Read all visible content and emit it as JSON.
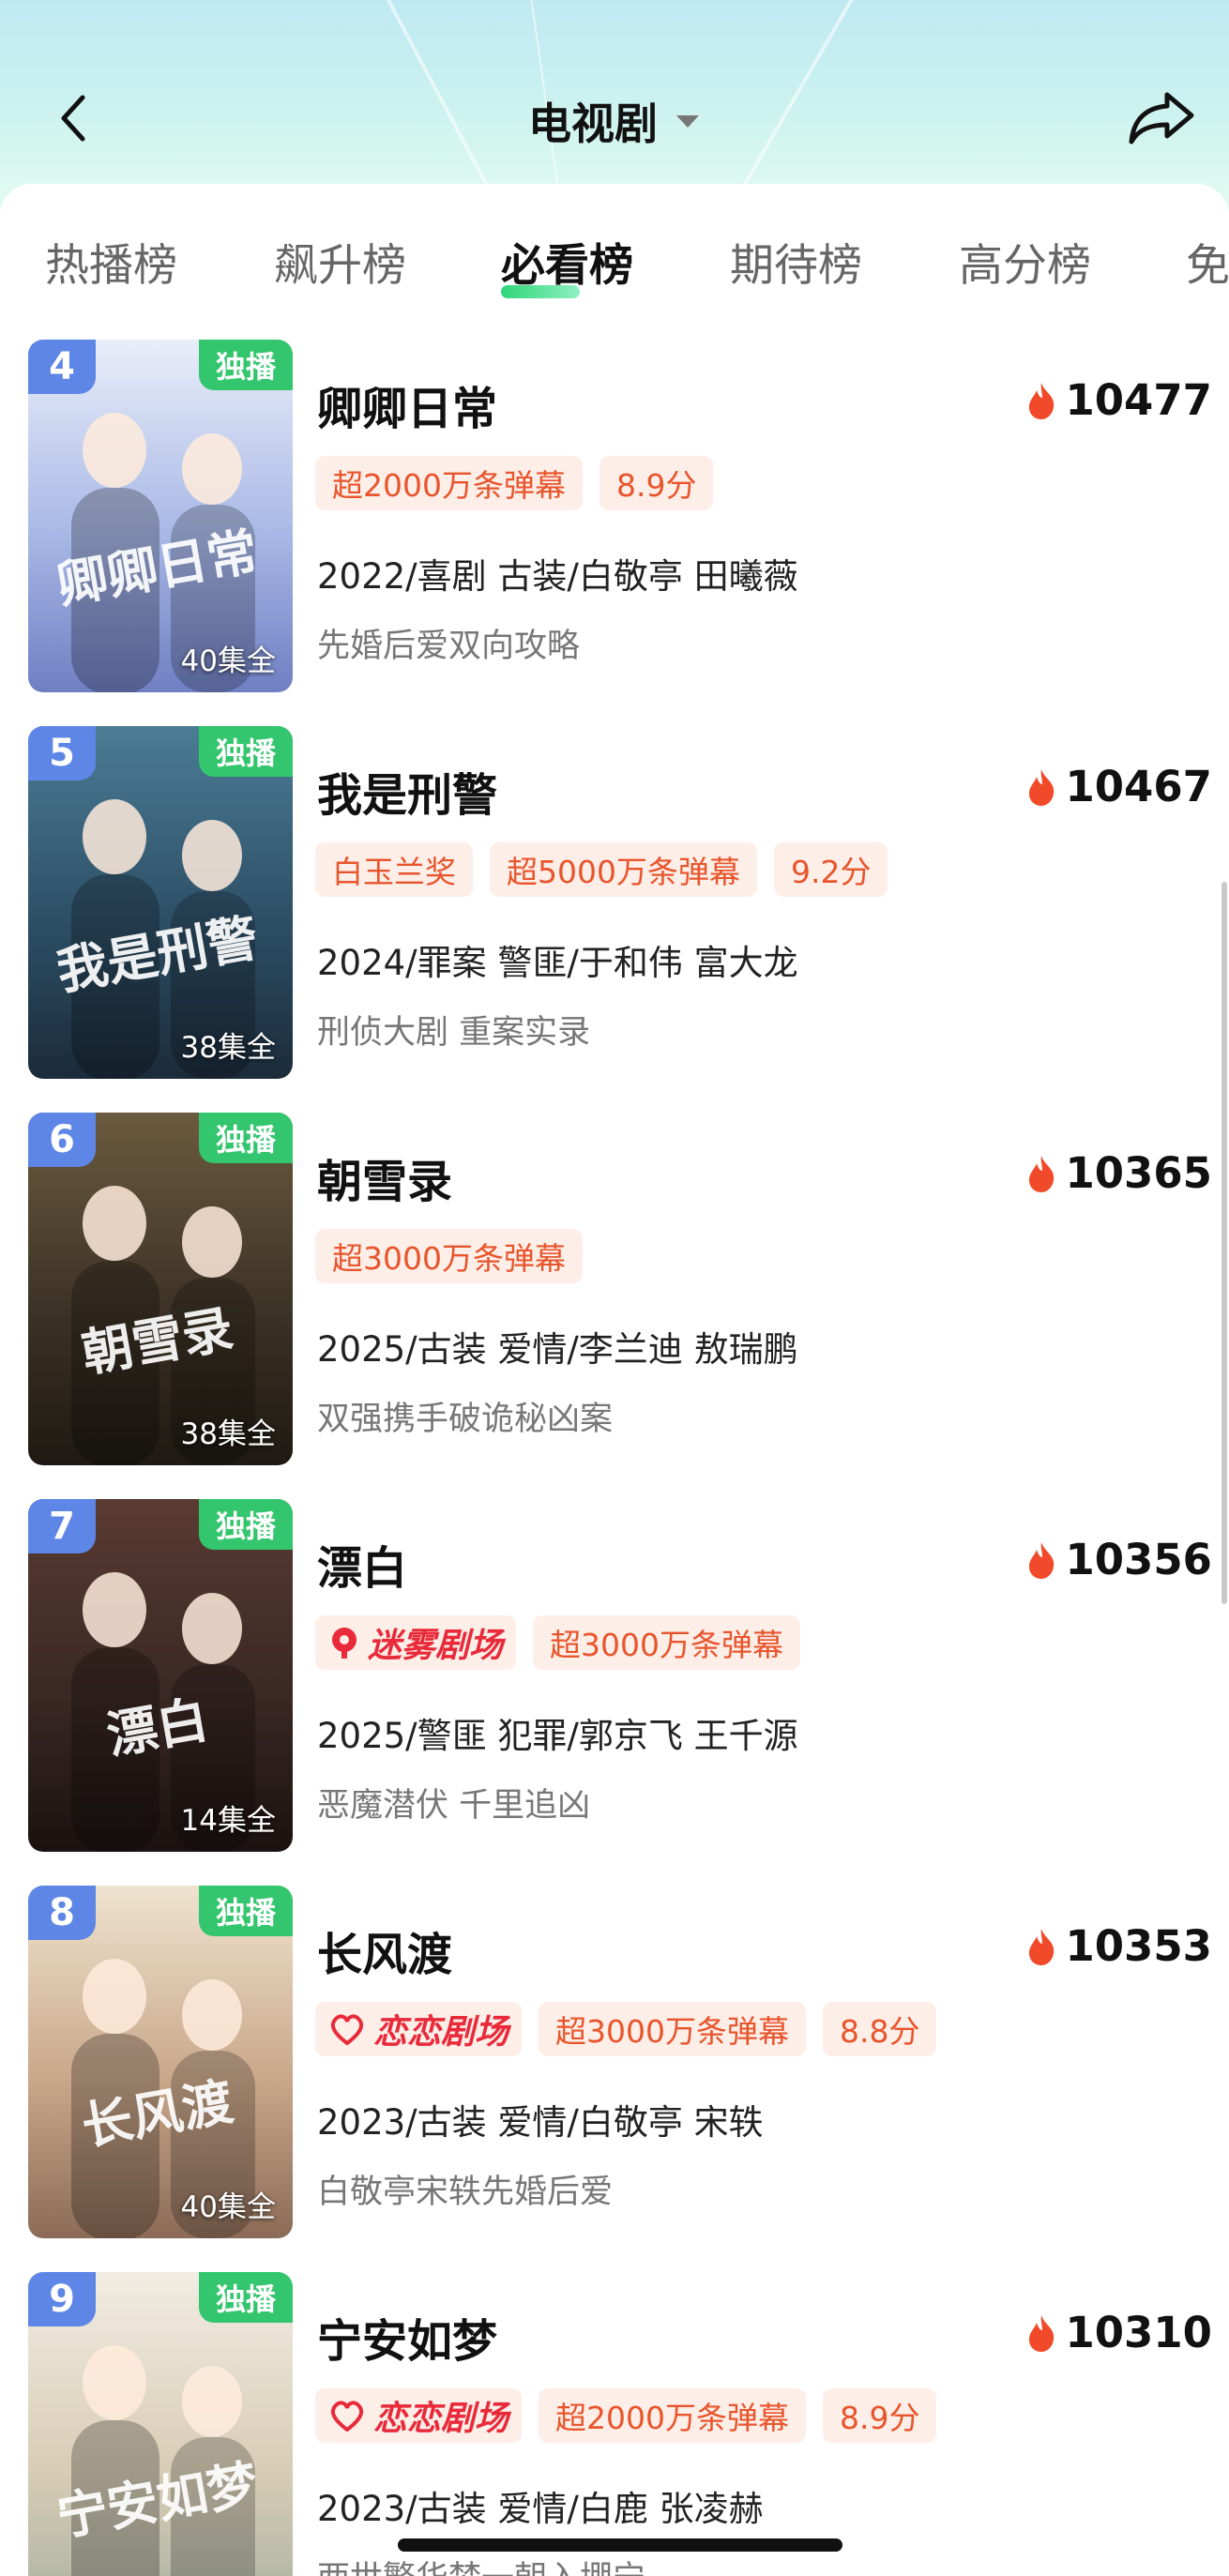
{
  "header": {
    "title": "电视剧",
    "back_icon": "chevron-left-icon",
    "dropdown_icon": "caret-down-icon",
    "share_icon": "share-arrow-icon"
  },
  "tabs": [
    {
      "label": "热播榜",
      "active": false
    },
    {
      "label": "飙升榜",
      "active": false
    },
    {
      "label": "必看榜",
      "active": true
    },
    {
      "label": "期待榜",
      "active": false
    },
    {
      "label": "高分榜",
      "active": false
    },
    {
      "label": "免",
      "active": false
    }
  ],
  "colors": {
    "accent_green": "#34c66e",
    "rank_blue": "#5d86e6",
    "tag_text": "#e8552c",
    "tag_bg": "#fdeee8",
    "heat_fire": "#f04a2a"
  },
  "list": [
    {
      "rank": "4",
      "exclusive": "独播",
      "episodes": "40集全",
      "title": "卿卿日常",
      "heat": "10477",
      "tags": [
        {
          "type": "text",
          "text": "超2000万条弹幕"
        },
        {
          "type": "text",
          "text": "8.9分"
        }
      ],
      "meta": "2022/喜剧 古装/白敬亭 田曦薇",
      "desc": "先婚后爱双向攻略",
      "poster_text": "卿卿日常",
      "poster_colors": [
        "#e9eef9",
        "#a8b8e6",
        "#6f7fc2"
      ]
    },
    {
      "rank": "5",
      "exclusive": "独播",
      "episodes": "38集全",
      "title": "我是刑警",
      "heat": "10467",
      "tags": [
        {
          "type": "text",
          "text": "白玉兰奖"
        },
        {
          "type": "text",
          "text": "超5000万条弹幕"
        },
        {
          "type": "text",
          "text": "9.2分"
        }
      ],
      "meta": "2024/罪案 警匪/于和伟 富大龙",
      "desc": "刑侦大剧 重案实录",
      "poster_text": "我是刑警",
      "poster_colors": [
        "#4a7d95",
        "#2d4f66",
        "#1b2b3a"
      ]
    },
    {
      "rank": "6",
      "exclusive": "独播",
      "episodes": "38集全",
      "title": "朝雪录",
      "heat": "10365",
      "tags": [
        {
          "type": "text",
          "text": "超3000万条弹幕"
        }
      ],
      "meta": "2025/古装 爱情/李兰迪 敖瑞鹏",
      "desc": "双强携手破诡秘凶案",
      "poster_text": "朝雪录",
      "poster_colors": [
        "#6b5a3e",
        "#3d3326",
        "#1e1912"
      ]
    },
    {
      "rank": "7",
      "exclusive": "独播",
      "episodes": "14集全",
      "title": "漂白",
      "heat": "10356",
      "tags": [
        {
          "type": "brand",
          "text": "迷雾剧场",
          "icon": "mist-theater-logo-icon"
        },
        {
          "type": "text",
          "text": "超3000万条弹幕"
        }
      ],
      "meta": "2025/警匪 犯罪/郭京飞 王千源",
      "desc": "恶魔潜伏 千里追凶",
      "poster_text": "漂白",
      "poster_colors": [
        "#5a3b32",
        "#3a2824",
        "#1a1210"
      ]
    },
    {
      "rank": "8",
      "exclusive": "独播",
      "episodes": "40集全",
      "title": "长风渡",
      "heat": "10353",
      "tags": [
        {
          "type": "brand",
          "text": "恋恋剧场",
          "icon": "love-theater-logo-icon"
        },
        {
          "type": "text",
          "text": "超3000万条弹幕"
        },
        {
          "type": "text",
          "text": "8.8分"
        }
      ],
      "meta": "2023/古装 爱情/白敬亭 宋轶",
      "desc": "白敬亭宋轶先婚后爱",
      "poster_text": "长风渡",
      "poster_colors": [
        "#efe3cf",
        "#c9a78a",
        "#8b6b57"
      ]
    },
    {
      "rank": "9",
      "exclusive": "独播",
      "episodes": "",
      "title": "宁安如梦",
      "heat": "10310",
      "tags": [
        {
          "type": "brand",
          "text": "恋恋剧场",
          "icon": "love-theater-logo-icon"
        },
        {
          "type": "text",
          "text": "超2000万条弹幕"
        },
        {
          "type": "text",
          "text": "8.9分"
        }
      ],
      "meta": "2023/古装 爱情/白鹿 张凌赫",
      "desc": "两世繁华梦一朝入堋宁",
      "poster_text": "宁安如梦",
      "poster_colors": [
        "#f1ece2",
        "#d9cdb6",
        "#a7b0a0"
      ]
    }
  ]
}
